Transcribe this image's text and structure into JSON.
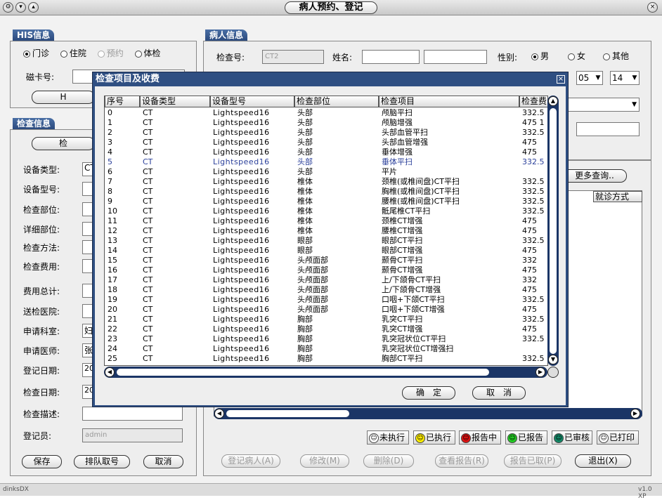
{
  "window": {
    "title": "病人预约、登记",
    "statusbar_left": "dinksDX",
    "statusbar_right": "v1.0 XP"
  },
  "his": {
    "tab": "HIS信息",
    "options": [
      "门诊",
      "住院",
      "预约",
      "体检"
    ],
    "selected": "门诊",
    "card_label": "磁卡号:",
    "button_partial": "H"
  },
  "patient": {
    "tab": "病人信息",
    "exam_no_label": "检查号:",
    "exam_no_value": "CT2",
    "name_label": "姓名:",
    "gender_label": "性别:",
    "genders": [
      "男",
      "女",
      "其他"
    ],
    "gender_selected": "男",
    "month": "05",
    "day": "14"
  },
  "exam": {
    "tab": "检查信息",
    "button_partial": "检",
    "labels": [
      "设备类型:",
      "设备型号:",
      "检查部位:",
      "详细部位:",
      "检查方法:",
      "检查费用:",
      "费用总计:",
      "送检医院:",
      "申请科室:",
      "申请医师:",
      "登记日期:",
      "检查日期:",
      "检查描述:",
      "登记员:"
    ],
    "device_type_partial": "CT",
    "dept_partial": "妇",
    "doctor_partial": "张",
    "reg_date_partial": "20",
    "exam_date_partial": "20",
    "registrar": "admin",
    "buttons": [
      "保存",
      "排队取号",
      "取消"
    ]
  },
  "right": {
    "more_query": "更多查询..",
    "visit_col": "就诊方式",
    "status_buttons": [
      {
        "label": "未执行",
        "color": "#ffffff",
        "icon": "smiley-white-icon"
      },
      {
        "label": "已执行",
        "color": "#ffee00",
        "icon": "smiley-yellow-icon"
      },
      {
        "label": "报告中",
        "color": "#dd1111",
        "icon": "smiley-red-icon"
      },
      {
        "label": "已报告",
        "color": "#22cc22",
        "icon": "smiley-green-icon"
      },
      {
        "label": "已审核",
        "color": "#118866",
        "icon": "smiley-teal-icon"
      },
      {
        "label": "已打印",
        "color": "#ffffff",
        "icon": "smiley-white-icon"
      }
    ],
    "actions": [
      "登记病人(A)",
      "修改(M)",
      "删除(D)",
      "查看报告(R)",
      "报告已取(P)",
      "退出(X)"
    ]
  },
  "dialog": {
    "title": "检查项目及收费",
    "close": "×",
    "columns": [
      "序号",
      "设备类型",
      "设备型号",
      "检查部位",
      "检查项目",
      "检查费"
    ],
    "rows": [
      [
        "0",
        "CT",
        "Lightspeed16",
        "头部",
        "颅脑平扫",
        "332.5"
      ],
      [
        "1",
        "CT",
        "Lightspeed16",
        "头部",
        "颅脑增强",
        "475 1"
      ],
      [
        "2",
        "CT",
        "Lightspeed16",
        "头部",
        "头部血管平扫",
        "332.5"
      ],
      [
        "3",
        "CT",
        "Lightspeed16",
        "头部",
        "头部血管增强",
        "475"
      ],
      [
        "4",
        "CT",
        "Lightspeed16",
        "头部",
        "垂体增强",
        "475"
      ],
      [
        "5",
        "CT",
        "Lightspeed16",
        "头部",
        "垂体平扫",
        "332.5"
      ],
      [
        "6",
        "CT",
        "Lightspeed16",
        "头部",
        "平片",
        ""
      ],
      [
        "7",
        "CT",
        "Lightspeed16",
        "椎体",
        "颈椎(或椎间盘)CT平扫",
        "332.5"
      ],
      [
        "8",
        "CT",
        "Lightspeed16",
        "椎体",
        "胸椎(或椎间盘)CT平扫",
        "332.5"
      ],
      [
        "9",
        "CT",
        "Lightspeed16",
        "椎体",
        "腰椎(或椎间盘)CT平扫",
        "332.5"
      ],
      [
        "10",
        "CT",
        "Lightspeed16",
        "椎体",
        "骶尾椎CT平扫",
        "332.5"
      ],
      [
        "11",
        "CT",
        "Lightspeed16",
        "椎体",
        "颈椎CT增强",
        "475"
      ],
      [
        "12",
        "CT",
        "Lightspeed16",
        "椎体",
        "腰椎CT增强",
        "475"
      ],
      [
        "13",
        "CT",
        "Lightspeed16",
        "眼部",
        "眼部CT平扫",
        "332.5"
      ],
      [
        "14",
        "CT",
        "Lightspeed16",
        "眼部",
        "眼部CT增强",
        "475"
      ],
      [
        "15",
        "CT",
        "Lightspeed16",
        "头颅面部",
        "颞骨CT平扫",
        "332"
      ],
      [
        "16",
        "CT",
        "Lightspeed16",
        "头颅面部",
        "颞骨CT增强",
        "475"
      ],
      [
        "17",
        "CT",
        "Lightspeed16",
        "头颅面部",
        "上/下颌骨CT平扫",
        "332"
      ],
      [
        "18",
        "CT",
        "Lightspeed16",
        "头颅面部",
        "上/下颌骨CT增强",
        "475"
      ],
      [
        "19",
        "CT",
        "Lightspeed16",
        "头颅面部",
        "口咽+下颌CT平扫",
        "332.5"
      ],
      [
        "20",
        "CT",
        "Lightspeed16",
        "头颅面部",
        "口咽+下颌CT增强",
        "475"
      ],
      [
        "21",
        "CT",
        "Lightspeed16",
        "胸部",
        "乳突CT平扫",
        "332.5"
      ],
      [
        "22",
        "CT",
        "Lightspeed16",
        "胸部",
        "乳突CT增强",
        "475"
      ],
      [
        "23",
        "CT",
        "Lightspeed16",
        "胸部",
        "乳突冠状位CT平扫",
        "332.5"
      ],
      [
        "24",
        "CT",
        "Lightspeed16",
        "胸部",
        "乳突冠状位CT增强扫",
        ""
      ],
      [
        "25",
        "CT",
        "Lightspeed16",
        "胸部",
        "胸部CT平扫",
        "332.5"
      ]
    ],
    "selected_row": 5,
    "ok": "确　定",
    "cancel": "取　消"
  }
}
